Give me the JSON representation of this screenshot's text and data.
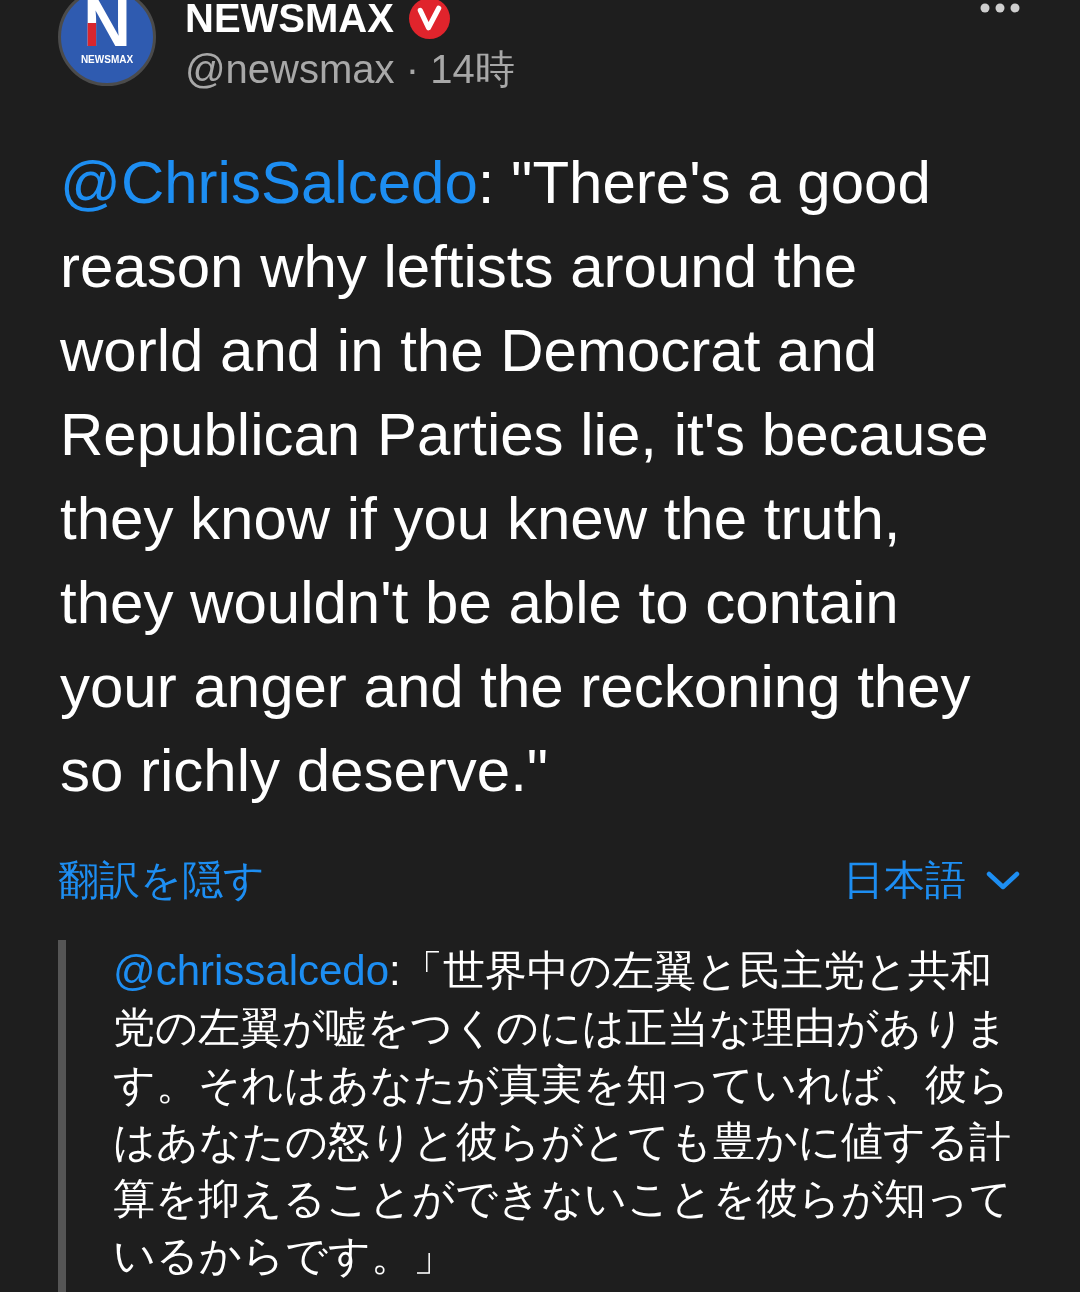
{
  "post": {
    "author": {
      "avatar": {
        "logo_letter": "N",
        "logo_text": "NEWSMAX"
      },
      "name": "NEWSMAX",
      "verified": true,
      "handle": "@newsmax",
      "separator": "·",
      "time": "14時"
    },
    "text": {
      "mention": "@ChrisSalcedo",
      "body": ": \"There's a good reason why leftists around the world and in the Democrat and Republican Parties lie, it's because they know if you knew the truth, they wouldn't be able to contain your anger and the reckoning they so richly deserve.\""
    },
    "translation_toggle": "翻訳を隠す",
    "language": "日本語",
    "translation": {
      "mention": "@chrissalcedo",
      "body": ":「世界中の左翼と民主党と共和党の左翼が嘘をつくのには正当な理由があります。それはあなたが真実を知っていれば、彼らはあなたの怒りと彼らがとても豊かに値する計算を抑えることができないことを彼らが知っているからです。」"
    }
  }
}
